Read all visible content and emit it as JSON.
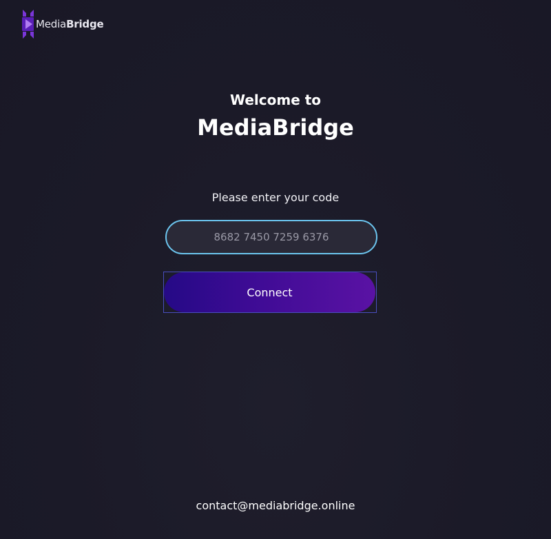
{
  "header": {
    "logo_icon": "mediabridge-logo-icon",
    "logo_text_light": "Media",
    "logo_text_bold": "Bridge"
  },
  "main": {
    "welcome_line": "Welcome to",
    "brand_title": "MediaBridge",
    "code_prompt": "Please enter your code",
    "code_input": {
      "placeholder": "8682 7450 7259 6376",
      "value": ""
    },
    "connect_label": "Connect"
  },
  "footer": {
    "contact_email": "contact@mediabridge.online"
  },
  "colors": {
    "background": "#1b1a28",
    "input_border": "#6cc6f0",
    "button_gradient_start": "#250a86",
    "button_gradient_end": "#5a12a4",
    "logo_accent": "#6a2fd0"
  }
}
